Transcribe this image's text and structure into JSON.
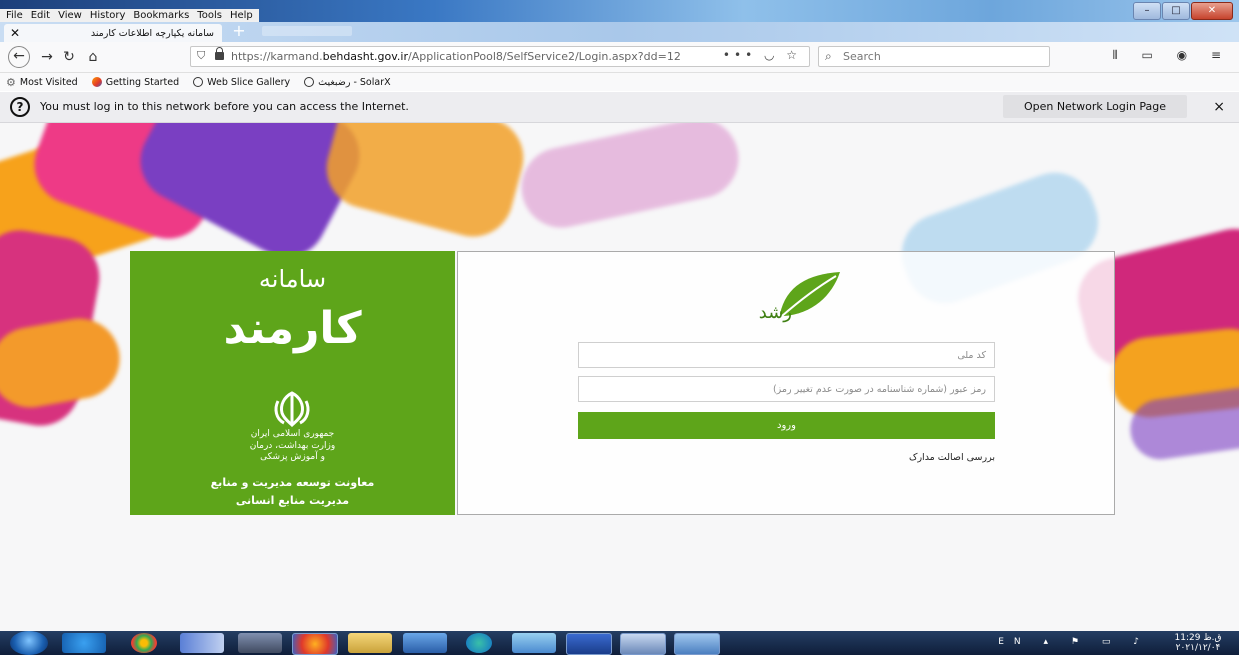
{
  "browser": {
    "menu": [
      "File",
      "Edit",
      "View",
      "History",
      "Bookmarks",
      "Tools",
      "Help"
    ],
    "tab_title": "سامانه یکپارچه اطلاعات کارمند",
    "new_tab": "+",
    "url_prefix": "https://karmand.",
    "url_domain": "behdasht.gov.ir",
    "url_rest": "/ApplicationPool8/SelfService2/Login.aspx?dd=12",
    "url_actions": "••• ◡ ☆",
    "search_placeholder": "Search",
    "bookmarks": [
      "Most Visited",
      "Getting Started",
      "Web Slice Gallery",
      "رضبغیث - SolarX"
    ]
  },
  "notification": {
    "message": "You must log in to this network before you can access the Internet.",
    "button": "Open Network Login Page",
    "close": "×"
  },
  "brand_panel": {
    "line1": "سامانه",
    "line2": "کارمند",
    "ministry1": "جمهوری اسلامی ایران",
    "ministry2": "وزارت بهداشت، درمان",
    "ministry3": "و آموزش پزشکی",
    "dept1": "معاونت توسعه مدیریت و منابع",
    "dept2": "مدیریت منابع انسانی",
    "color": "#5ea51a"
  },
  "login": {
    "logo_text": "رشد",
    "national_code_placeholder": "کد ملی",
    "password_placeholder": "رمز عبور (شماره شناسنامه در صورت عدم تغییر رمز)",
    "submit_label": "ورود",
    "verify_link": "بررسی اصالت مدارک"
  },
  "taskbar": {
    "language": "EN",
    "time": "11:29 ق.ظ",
    "date": "۲۰۲۱/۱۲/۰۴"
  }
}
